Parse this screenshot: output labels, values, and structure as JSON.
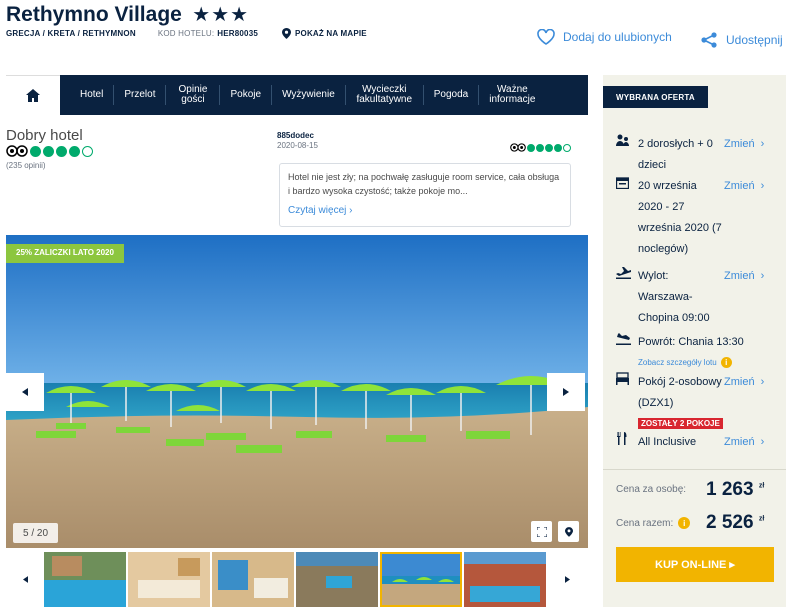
{
  "header": {
    "hotel_name": "Rethymno Village",
    "stars": "★★★",
    "breadcrumb": "GRECJA / KRETA / RETHYMNON",
    "code_label": "KOD HOTELU:",
    "code_value": "HER80035",
    "map_label": "POKAŻ NA MAPIE",
    "favorite_label": "Dodaj do ulubionych",
    "share_label": "Udostępnij"
  },
  "nav": {
    "items": [
      "Hotel",
      "Przelot",
      "Opinie gości",
      "Pokoje",
      "Wyżywienie",
      "Wycieczki fakultatywne",
      "Pogoda",
      "Ważne informacje"
    ]
  },
  "rating": {
    "title": "Dobry hotel",
    "score": 4,
    "max": 5,
    "count": "(235 opinii)"
  },
  "review": {
    "author": "885dodec",
    "date": "2020-08-15",
    "score": 4,
    "text": "Hotel nie jest zły; na pochwałę zasługuje room service, cała obsługa i bardzo wysoka czystość; także pokoje mo...",
    "more_label": "Czytaj więcej"
  },
  "gallery": {
    "promo": "25% ZALICZKI LATO 2020",
    "counter": "5 / 20",
    "active_thumb": 4
  },
  "offer": {
    "header": "WYBRANA OFERTA",
    "travelers": "2 dorosłych + 0 dzieci",
    "dates": "20 września 2020 - 27 września 2020 (7 noclegów)",
    "departure": "Wylot: Warszawa-Chopina 09:00",
    "return": "Powrót: Chania 13:30",
    "flight_details": "Zobacz szczegóły lotu",
    "room": "Pokój 2-osobowy (DZX1)",
    "rooms_left": "ZOSTAŁY 2 POKOJE",
    "board": "All Inclusive",
    "change_label": "Zmień",
    "price_person_label": "Cena za osobę:",
    "price_person": "1 263",
    "price_total_label": "Cena razem:",
    "price_total": "2 526",
    "currency": "zł",
    "buy_label": "KUP ON-LINE ▸"
  },
  "colors": {
    "navy": "#0a2240",
    "link": "#3c8bd9",
    "accent": "#f2b400",
    "green": "#8cc63f",
    "tripadvisor": "#00aa6c"
  }
}
